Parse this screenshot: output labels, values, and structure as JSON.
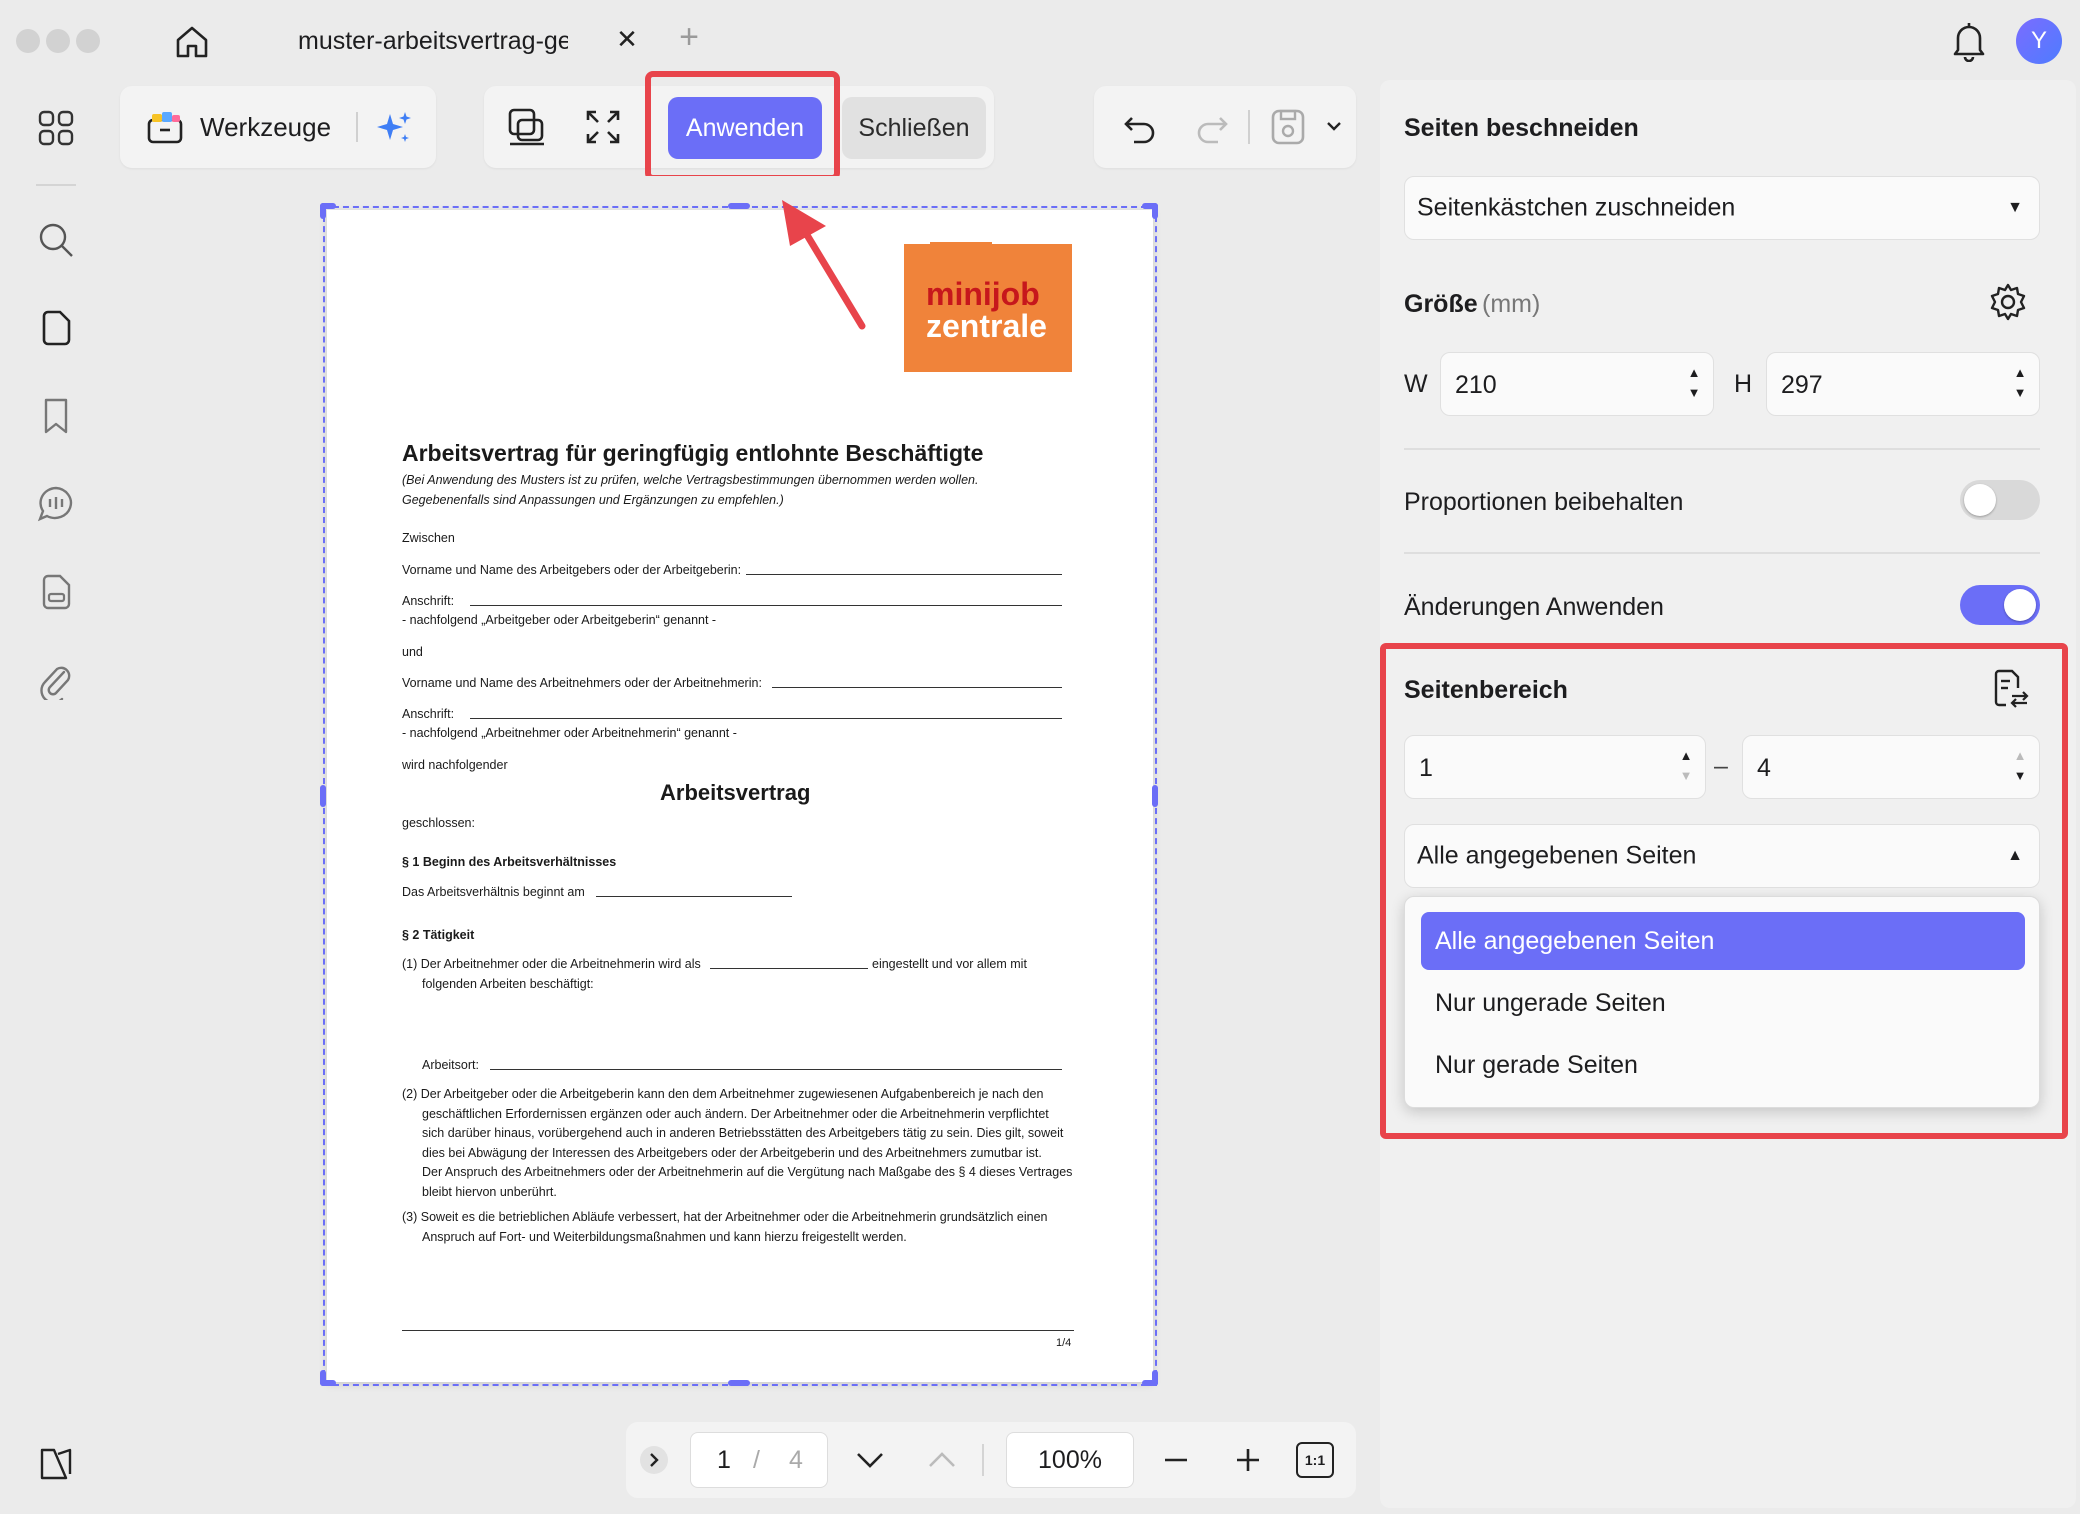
{
  "window": {
    "tab_title": "muster-arbeitsvertrag-gewerblich",
    "avatar_initial": "Y"
  },
  "toolbar": {
    "tools_label": "Werkzeuge",
    "apply_label": "Anwenden",
    "close_label": "Schließen"
  },
  "document": {
    "logo_line1": "minijob",
    "logo_line2": "zentrale",
    "title": "Arbeitsvertrag für geringfügig entlohnte Beschäftigte",
    "subtitle1": "(Bei Anwendung des Musters ist zu prüfen, welche Vertragsbestimmungen übernommen werden wollen.",
    "subtitle2": "Gegebenenfalls sind Anpassungen und Ergänzungen zu empfehlen.)",
    "zwischen": "Zwischen",
    "arbeitgeber_name": "Vorname und Name des Arbeitgebers oder der Arbeitgeberin:",
    "anschrift1": "Anschrift:",
    "nachfolgend1": "- nachfolgend „Arbeitgeber oder Arbeitgeberin“ genannt -",
    "und": "und",
    "arbeitnehmer_name": "Vorname und Name des Arbeitnehmers oder der Arbeitnehmerin:",
    "anschrift2": "Anschrift:",
    "nachfolgend2": "- nachfolgend „Arbeitnehmer oder Arbeitnehmerin“ genannt -",
    "wird": "wird nachfolgender",
    "heading": "Arbeitsvertrag",
    "geschlossen": "geschlossen:",
    "s1": "§ 1 Beginn des Arbeitsverhältnisses",
    "s1_text": "Das Arbeitsverhältnis beginnt am",
    "s2": "§ 2 Tätigkeit",
    "s2_1a": "(1) Der Arbeitnehmer oder die Arbeitnehmerin wird als",
    "s2_1b": "eingestellt und vor allem mit",
    "s2_1c": "folgenden Arbeiten beschäftigt:",
    "arbeitsort": "Arbeitsort:",
    "s2_2a": "(2) Der Arbeitgeber oder die Arbeitgeberin kann den dem Arbeitnehmer zugewiesenen Aufgabenbereich je nach den",
    "s2_2b": "geschäftlichen Erfordernissen ergänzen oder auch ändern. Der Arbeitnehmer oder die Arbeitnehmerin verpflichtet",
    "s2_2c": "sich darüber hinaus, vorübergehend auch in anderen Betriebsstätten des Arbeitgebers tätig zu sein. Dies gilt, soweit",
    "s2_2d": "dies bei Abwägung der Interessen des Arbeitgebers oder der Arbeitgeberin und des Arbeitnehmers zumutbar ist.",
    "s2_2e": "Der Anspruch des Arbeitnehmers oder der Arbeitnehmerin auf die Vergütung nach Maßgabe des § 4 dieses Vertrages",
    "s2_2f": "bleibt hiervon unberührt.",
    "s2_3a": "(3) Soweit es die betrieblichen Abläufe verbessert, hat der Arbeitnehmer oder die Arbeitnehmerin grundsätzlich einen",
    "s2_3b": "Anspruch auf Fort- und Weiterbildungsmaßnahmen und kann hierzu freigestellt werden.",
    "footer_page": "1/4"
  },
  "pager": {
    "current_page": "1",
    "separator": "/",
    "total_pages": "4",
    "zoom": "100%",
    "fit_label": "1:1"
  },
  "panel": {
    "crop_title": "Seiten beschneiden",
    "crop_mode": "Seitenkästchen zuschneiden",
    "size_title": "Größe",
    "size_unit": "(mm)",
    "w_label": "W",
    "w_value": "210",
    "h_label": "H",
    "h_value": "297",
    "keep_ratio_label": "Proportionen beibehalten",
    "keep_ratio_on": false,
    "apply_changes_label": "Änderungen Anwenden",
    "apply_changes_on": true,
    "range_title": "Seitenbereich",
    "range_from": "1",
    "range_dash": "–",
    "range_to": "4",
    "range_mode": "Alle angegebenen Seiten",
    "range_options": [
      "Alle angegebenen Seiten",
      "Nur ungerade Seiten",
      "Nur gerade Seiten"
    ]
  },
  "colors": {
    "accent": "#6b6ef7",
    "highlight": "#e8444b",
    "logo_orange": "#f0833a",
    "logo_red": "#c6171c"
  }
}
